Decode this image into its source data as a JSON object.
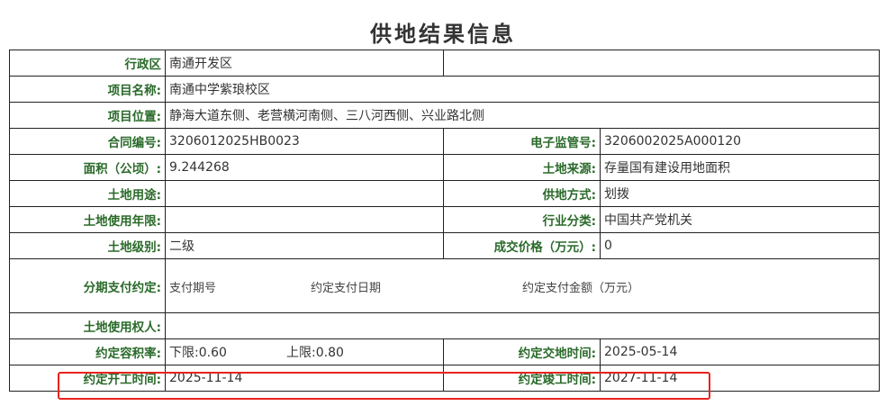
{
  "title": "供地结果信息",
  "rows": {
    "district": {
      "label": "行政区",
      "value": "南通开发区"
    },
    "project_name": {
      "label": "项目名称:",
      "value": "南通中学紫琅校区"
    },
    "project_location": {
      "label": "项目位置:",
      "value": "静海大道东侧、老营横河南侧、三八河西侧、兴业路北侧"
    },
    "contract_no": {
      "label": "合同编号:",
      "value": "3206012025HB0023"
    },
    "e_supervision_no": {
      "label": "电子监管号:",
      "value": "3206002025A000120"
    },
    "area": {
      "label": "面积（公顷）:",
      "value": "9.244268"
    },
    "land_source": {
      "label": "土地来源:",
      "value": "存量国有建设用地面积"
    },
    "land_use": {
      "label": "土地用途:",
      "value": ""
    },
    "supply_method": {
      "label": "供地方式:",
      "value": "划拨"
    },
    "use_years": {
      "label": "土地使用年限:",
      "value": ""
    },
    "industry": {
      "label": "行业分类:",
      "value": "中国共产党机关"
    },
    "land_grade": {
      "label": "土地级别:",
      "value": "二级"
    },
    "price": {
      "label": "成交价格（万元）:",
      "value": "0"
    },
    "installment": {
      "label": "分期支付约定:",
      "col1": "支付期号",
      "col2": "约定支付日期",
      "col3": "约定支付金额（万元）"
    },
    "land_user": {
      "label": "土地使用权人:",
      "value": ""
    },
    "far": {
      "label": "约定容积率:",
      "lower_label": "下限:",
      "lower_value": "0.60",
      "upper_label": "上限:",
      "upper_value": "0.80"
    },
    "delivery_date": {
      "label": "约定交地时间:",
      "value": "2025-05-14"
    },
    "start_date": {
      "label": "约定开工时间:",
      "value": "2025-11-14"
    },
    "completion_date": {
      "label": "约定竣工时间:",
      "value": "2027-11-14"
    }
  },
  "colors": {
    "label_green": "#2a6a2a",
    "highlight_red": "#e8231f"
  }
}
